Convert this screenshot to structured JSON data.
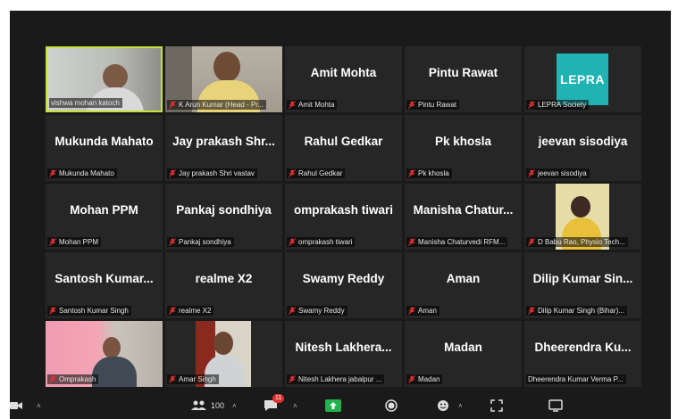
{
  "participants": [
    {
      "label": "vishwa mohan katoch",
      "name": "",
      "video": "person-grey",
      "muted": false,
      "active": true
    },
    {
      "label": "K Arun Kumar (Head - Pr...",
      "name": "",
      "video": "person-office",
      "muted": true
    },
    {
      "label": "Amit Mohta",
      "name": "Amit Mohta",
      "muted": true
    },
    {
      "label": "Pintu Rawat",
      "name": "Pintu Rawat",
      "muted": true
    },
    {
      "label": "LEPRA Society",
      "name": "",
      "logo": "LEPRA",
      "muted": true
    },
    {
      "label": "Mukunda Mahato",
      "name": "Mukunda Mahato",
      "muted": true
    },
    {
      "label": "Jay prakash Shri vastav",
      "name": "Jay prakash Shr...",
      "muted": true
    },
    {
      "label": "Rahul Gedkar",
      "name": "Rahul Gedkar",
      "muted": true
    },
    {
      "label": "Pk khosla",
      "name": "Pk khosla",
      "muted": true
    },
    {
      "label": "jeevan sisodiya",
      "name": "jeevan sisodiya",
      "muted": true
    },
    {
      "label": "Mohan PPM",
      "name": "Mohan PPM",
      "muted": true
    },
    {
      "label": "Pankaj sondhiya",
      "name": "Pankaj sondhiya",
      "muted": true
    },
    {
      "label": "omprakash tiwari",
      "name": "omprakash tiwari",
      "muted": true
    },
    {
      "label": "Manisha Chaturvedi RFM...",
      "name": "Manisha Chatur...",
      "muted": true
    },
    {
      "label": "D Babu Rao, Physio Tech...",
      "name": "",
      "video": "person-yellow",
      "muted": true
    },
    {
      "label": "Santosh Kumar Singh",
      "name": "Santosh Kumar...",
      "muted": true
    },
    {
      "label": "realme X2",
      "name": "realme X2",
      "muted": true
    },
    {
      "label": "Swamy Reddy",
      "name": "Swamy Reddy",
      "muted": true
    },
    {
      "label": "Aman",
      "name": "Aman",
      "muted": true
    },
    {
      "label": "Dilip Kumar Singh (Bihar)...",
      "name": "Dilip Kumar Sin...",
      "muted": true
    },
    {
      "label": "Omprakash",
      "name": "",
      "video": "person-pink",
      "muted": true
    },
    {
      "label": "Amar Singh",
      "name": "",
      "video": "person-door",
      "muted": true
    },
    {
      "label": "Nitesh Lakhera jabalpur ...",
      "name": "Nitesh Lakhera...",
      "muted": true
    },
    {
      "label": "Madan",
      "name": "Madan",
      "muted": true
    },
    {
      "label": "Dheerendra Kumar Verma P...",
      "name": "Dheerendra Ku...",
      "muted": false
    }
  ],
  "toolbar": {
    "participants_count": "100",
    "chat_badge": "11"
  },
  "colors": {
    "background": "#1a1a1a",
    "tile": "#262626",
    "active_border": "#c6e23a",
    "mute": "#e0302f",
    "share": "#22b14c",
    "lepra": "#1fb3b3"
  }
}
